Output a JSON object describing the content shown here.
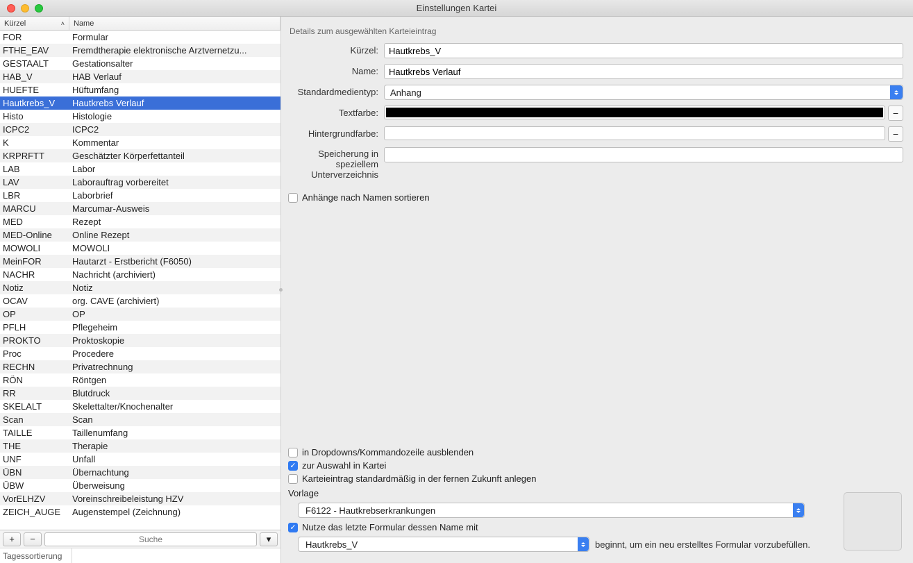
{
  "window_title": "Einstellungen Kartei",
  "table": {
    "header": {
      "kurzel": "Kürzel",
      "name": "Name"
    },
    "rows": [
      {
        "k": "FOR",
        "n": "Formular"
      },
      {
        "k": "FTHE_EAV",
        "n": "Fremdtherapie elektronische Arztvernetzu..."
      },
      {
        "k": "GESTAALT",
        "n": "Gestationsalter"
      },
      {
        "k": "HAB_V",
        "n": "HAB Verlauf"
      },
      {
        "k": "HUEFTE",
        "n": "Hüftumfang"
      },
      {
        "k": "Hautkrebs_V",
        "n": "Hautkrebs Verlauf",
        "selected": true
      },
      {
        "k": "Histo",
        "n": "Histologie"
      },
      {
        "k": "ICPC2",
        "n": "ICPC2"
      },
      {
        "k": "K",
        "n": "Kommentar"
      },
      {
        "k": "KRPRFTT",
        "n": "Geschätzter Körperfettanteil"
      },
      {
        "k": "LAB",
        "n": "Labor"
      },
      {
        "k": "LAV",
        "n": "Laborauftrag vorbereitet"
      },
      {
        "k": "LBR",
        "n": "Laborbrief"
      },
      {
        "k": "MARCU",
        "n": "Marcumar-Ausweis"
      },
      {
        "k": "MED",
        "n": "Rezept"
      },
      {
        "k": "MED-Online",
        "n": "Online Rezept"
      },
      {
        "k": "MOWOLI",
        "n": "MOWOLI"
      },
      {
        "k": "MeinFOR",
        "n": "Hautarzt - Erstbericht (F6050)"
      },
      {
        "k": "NACHR",
        "n": "Nachricht (archiviert)"
      },
      {
        "k": "Notiz",
        "n": "Notiz"
      },
      {
        "k": "OCAV",
        "n": "org. CAVE (archiviert)"
      },
      {
        "k": "OP",
        "n": "OP"
      },
      {
        "k": "PFLH",
        "n": "Pflegeheim"
      },
      {
        "k": "PROKTO",
        "n": "Proktoskopie"
      },
      {
        "k": "Proc",
        "n": "Procedere"
      },
      {
        "k": "RECHN",
        "n": "Privatrechnung"
      },
      {
        "k": "RÖN",
        "n": "Röntgen"
      },
      {
        "k": "RR",
        "n": "Blutdruck"
      },
      {
        "k": "SKELALT",
        "n": "Skelettalter/Knochenalter"
      },
      {
        "k": "Scan",
        "n": "Scan"
      },
      {
        "k": "TAILLE",
        "n": "Taillenumfang"
      },
      {
        "k": "THE",
        "n": "Therapie"
      },
      {
        "k": "UNF",
        "n": "Unfall"
      },
      {
        "k": "ÜBN",
        "n": "Übernachtung"
      },
      {
        "k": "ÜBW",
        "n": "Überweisung"
      },
      {
        "k": "VorELHZV",
        "n": "Voreinschreibeleistung HZV"
      },
      {
        "k": "ZEICH_AUGE",
        "n": "Augenstempel (Zeichnung)"
      }
    ]
  },
  "search_placeholder": "Suche",
  "footer": {
    "tag": "Tagessortierung"
  },
  "details": {
    "title": "Details zum ausgewählten Karteieintrag",
    "labels": {
      "kurzel": "Kürzel:",
      "name": "Name:",
      "mediatype": "Standardmedientyp:",
      "textcolor": "Textfarbe:",
      "bgcolor": "Hintergrundfarbe:",
      "storage": "Speicherung in speziellem Unterverzeichnis"
    },
    "values": {
      "kurzel": "Hautkrebs_V",
      "name": "Hautkrebs Verlauf",
      "mediatype": "Anhang",
      "textcolor": "#000000",
      "bgcolor": "#ffffff",
      "storage": ""
    },
    "checks": {
      "sort_att": "Anhänge nach Namen sortieren",
      "hide_dd": "in Dropdowns/Kommandozeile ausblenden",
      "auswahl": "zur Auswahl in Kartei",
      "future": "Karteieintrag standardmäßig in der fernen Zukunft anlegen",
      "use_last": "Nutze das letzte Formular dessen Name mit"
    },
    "template_label": "Vorlage",
    "template_value": "F6122 - Hautkrebserkrankungen",
    "last_form_value": "Hautkrebs_V",
    "after_text": "beginnt, um ein neu erstelltes Formular vorzubefüllen."
  }
}
